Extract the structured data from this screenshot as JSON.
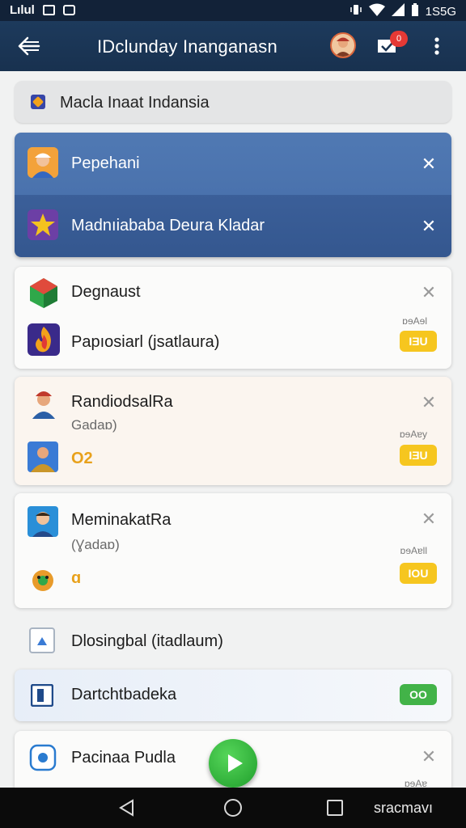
{
  "status_bar": {
    "carrier": "Lılul",
    "time": "1S5G",
    "icons": [
      "message-icon",
      "notification-icon",
      "vibrate-icon",
      "wifi-icon",
      "signal-icon",
      "battery-icon"
    ]
  },
  "app_bar": {
    "title": "IDclunday Inanganasn",
    "notification_count": "0",
    "colors": {
      "bar": "#18314f",
      "badge": "#e53935"
    }
  },
  "filter_chip": {
    "label": "Macla Inaat Indansia"
  },
  "highlighted": {
    "items": [
      {
        "label": "Pepehani",
        "icon": "person-avatar-icon"
      },
      {
        "label": "Madnıiababa Deura Kladar",
        "icon": "star-icon"
      }
    ],
    "colors": {
      "top": "#4a72ad",
      "bottom": "#34578f"
    }
  },
  "cards": [
    {
      "title": "Degnaust",
      "title_icon": "cube-icon",
      "item_label": "Papıosiarl (jsatlaura)",
      "item_icon": "flame-icon",
      "mini_label": "ɒɘAɘl",
      "pill": "ΙƎU"
    },
    {
      "title": "RandiodsalRa",
      "title_icon": "person-avatar-icon",
      "subtitle": "Gadaɒ)",
      "item_icon": "character-icon",
      "value": "O2",
      "mini_label": "ɒɘAɐy",
      "pill": "ΙƎU"
    },
    {
      "title": "MeminakatRa",
      "title_icon": "person-avatar-icon",
      "subtitle": "(Ɣadaɒ)",
      "item_icon": "gear-character-icon",
      "value": "ɑ",
      "mini_label": "ɒɘAɐll",
      "pill": "ΙOU"
    }
  ],
  "list_rows": [
    {
      "label": "Dlosingbal (itadlaum)",
      "icon": "document-icon"
    },
    {
      "label": "Dartchtbadeka",
      "icon": "square-icon",
      "pill": "OO"
    },
    {
      "label": "Pacinaa Pudla",
      "icon": "shield-icon",
      "mini_label": "ɒɘAɐ"
    }
  ],
  "fab": {
    "icon": "play-icon"
  },
  "nav_bar": {
    "label": "sracmavı"
  }
}
